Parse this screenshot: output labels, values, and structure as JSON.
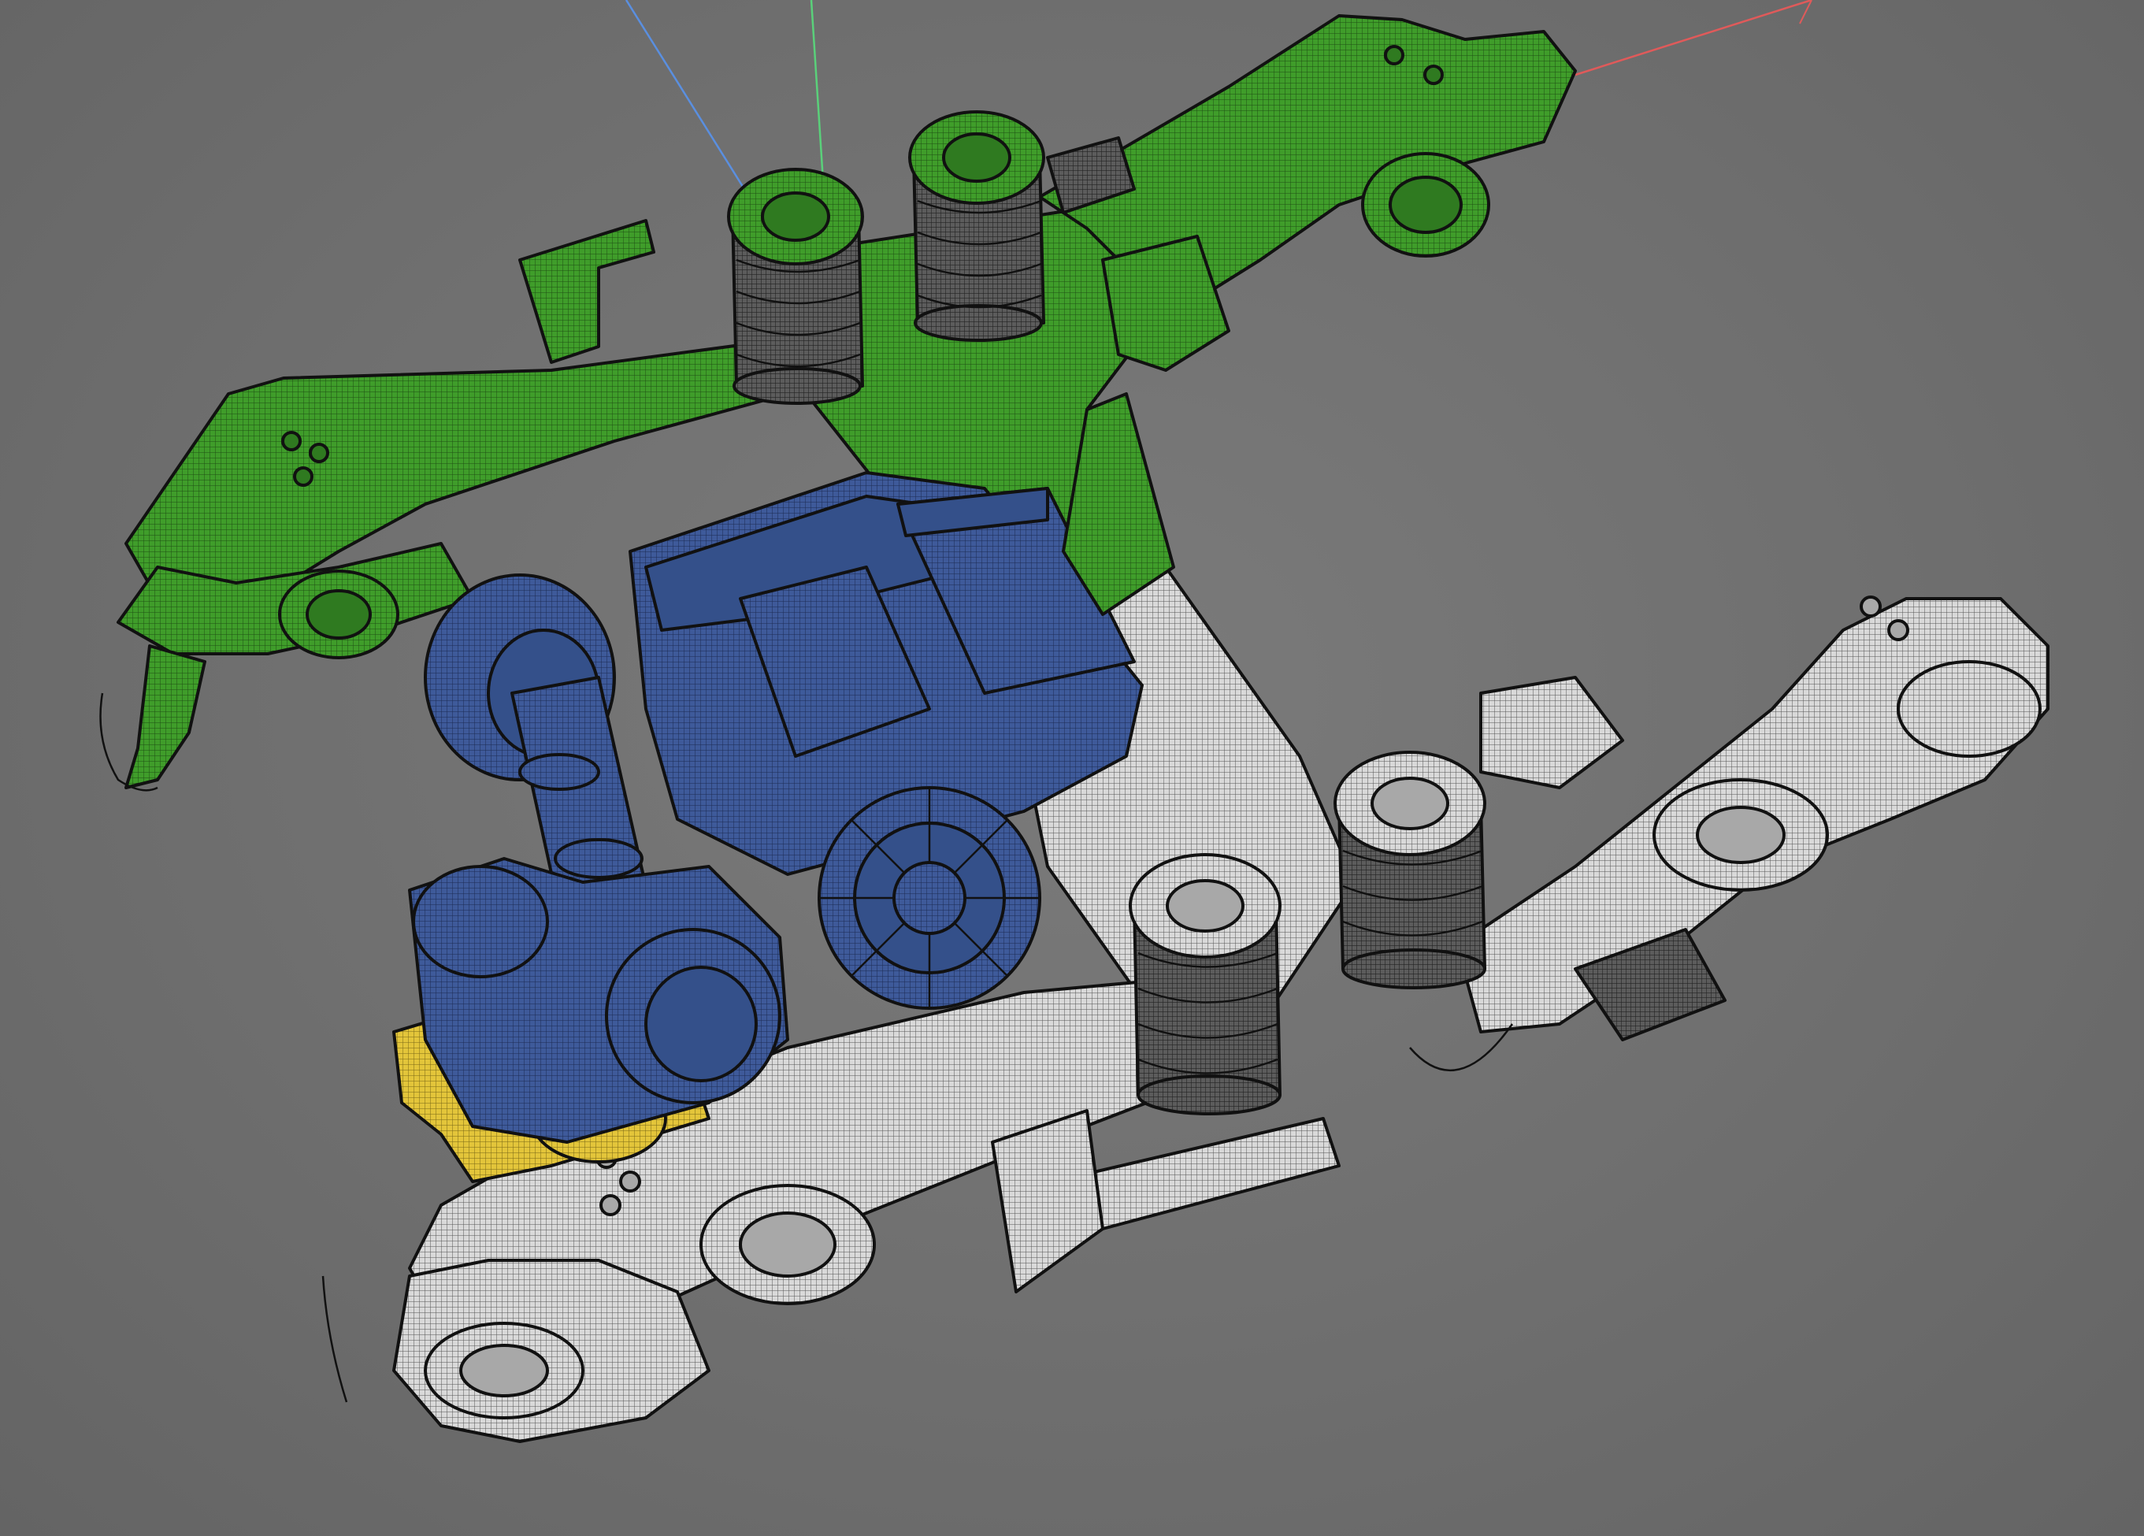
{
  "viewport": {
    "background": "#6f6f6f",
    "render_mode": "shaded-with-wireframe-edges"
  },
  "axis_gizmo": {
    "x_axis_color": "#e05a5a",
    "y_axis_color": "#5ad07a",
    "z_axis_color": "#5a8fe0"
  },
  "parts": [
    {
      "id": "frame-half-a",
      "color": "#3f9d2a"
    },
    {
      "id": "frame-half-b",
      "color": "#d9d9d9"
    },
    {
      "id": "traction-motor-gearbox",
      "color": "#3e5a9a"
    },
    {
      "id": "brake-bracket",
      "color": "#e3c53a"
    }
  ]
}
